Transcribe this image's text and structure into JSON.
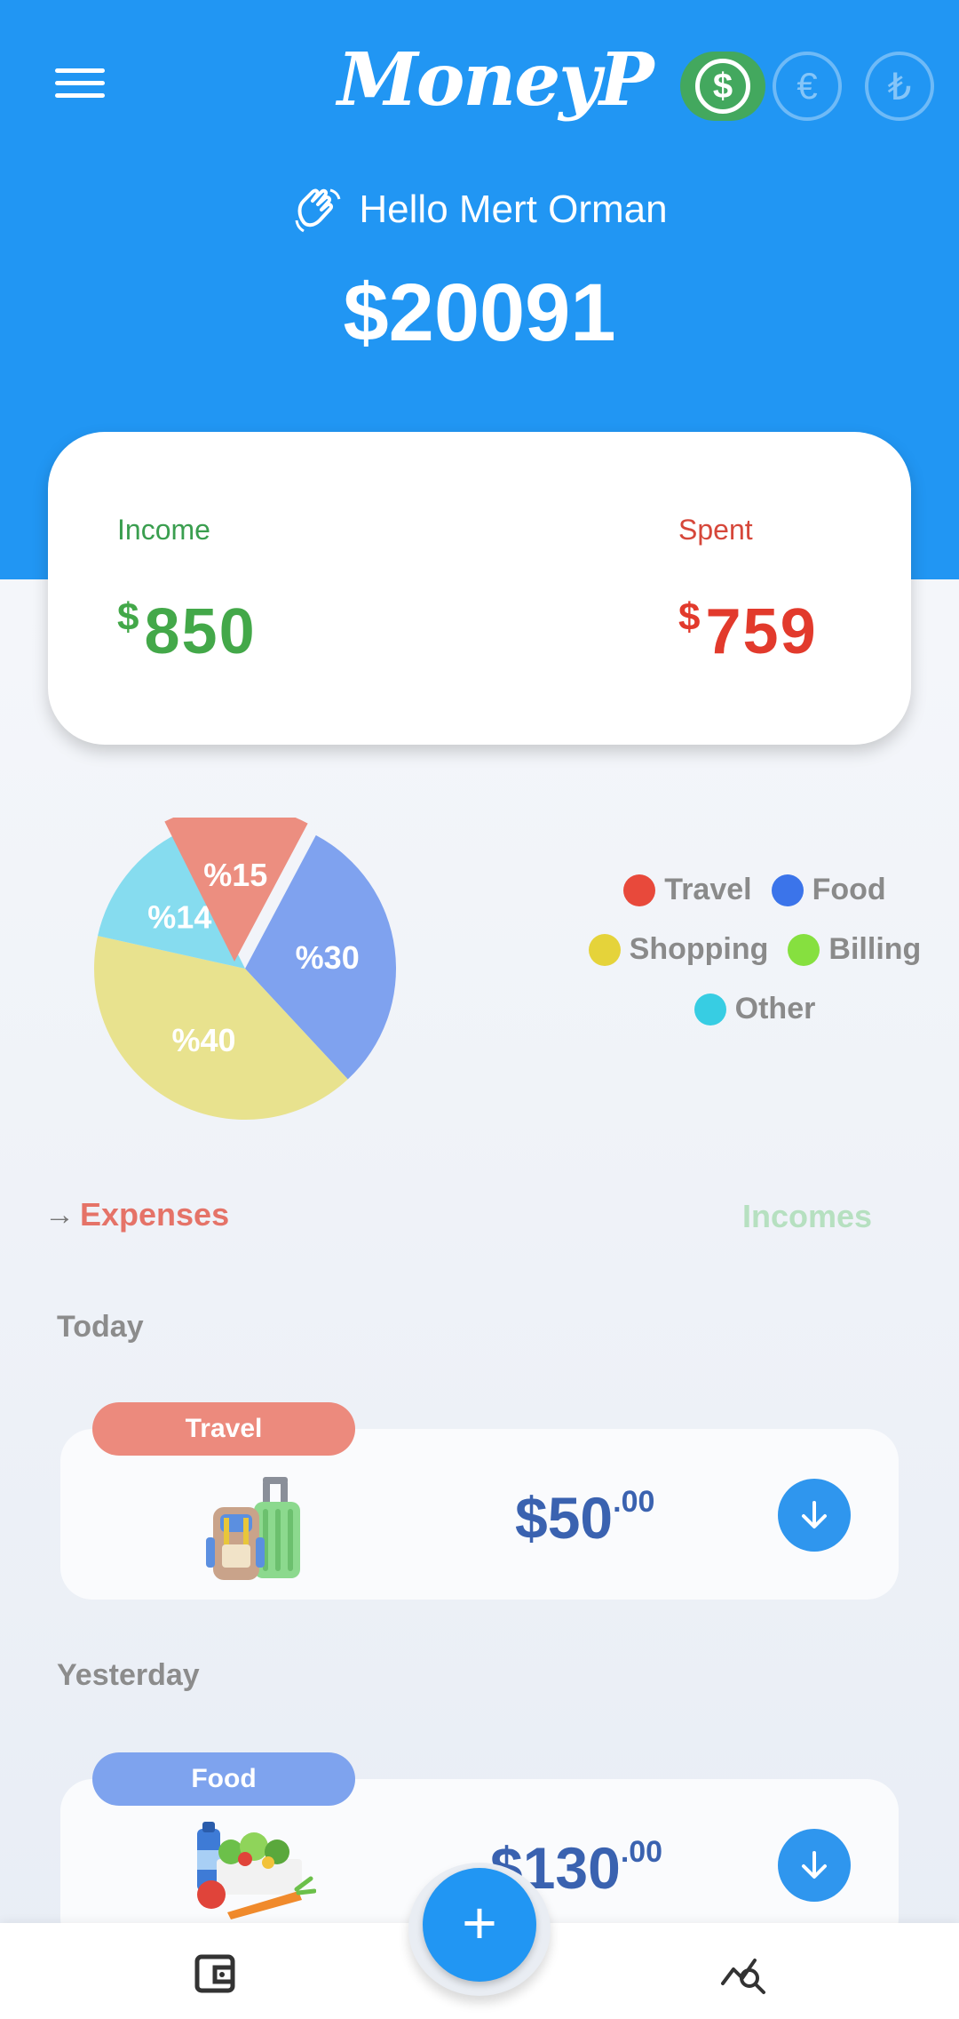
{
  "app": {
    "name": "MoneyP"
  },
  "currencies": [
    {
      "symbol": "$",
      "active": true
    },
    {
      "symbol": "€",
      "active": false
    },
    {
      "symbol": "₺",
      "active": false
    }
  ],
  "greeting": "Hello Mert Orman",
  "balance": "$20091",
  "summary": {
    "income_label": "Income",
    "income_currency": "$",
    "income_value": "850",
    "spent_label": "Spent",
    "spent_currency": "$",
    "spent_value": "759"
  },
  "chart_data": {
    "type": "pie",
    "slices": [
      {
        "label": "%30",
        "value": 30,
        "color": "#7fa2ef"
      },
      {
        "label": "%40",
        "value": 40,
        "color": "#e8e28e"
      },
      {
        "label": "%14",
        "value": 14,
        "color": "#86dcef"
      },
      {
        "label": "%15",
        "value": 15,
        "color": "#ec8e80"
      }
    ],
    "legend": [
      {
        "name": "Travel",
        "color": "#e8493b"
      },
      {
        "name": "Food",
        "color": "#3b74ea"
      },
      {
        "name": "Shopping",
        "color": "#e5d33a"
      },
      {
        "name": "Billing",
        "color": "#86e03f"
      },
      {
        "name": "Other",
        "color": "#37cde3"
      }
    ]
  },
  "tabs": {
    "expenses": "Expenses",
    "incomes": "Incomes"
  },
  "groups": [
    {
      "day": "Today",
      "category": "Travel",
      "badge_color": "#ec8a7d",
      "amount": "$50",
      "cents": ".00",
      "icon": "luggage-icon"
    },
    {
      "day": "Yesterday",
      "category": "Food",
      "badge_color": "#7ea3ee",
      "amount": "$130",
      "cents": ".00",
      "icon": "groceries-icon"
    }
  ],
  "fab": {
    "label": "+"
  }
}
